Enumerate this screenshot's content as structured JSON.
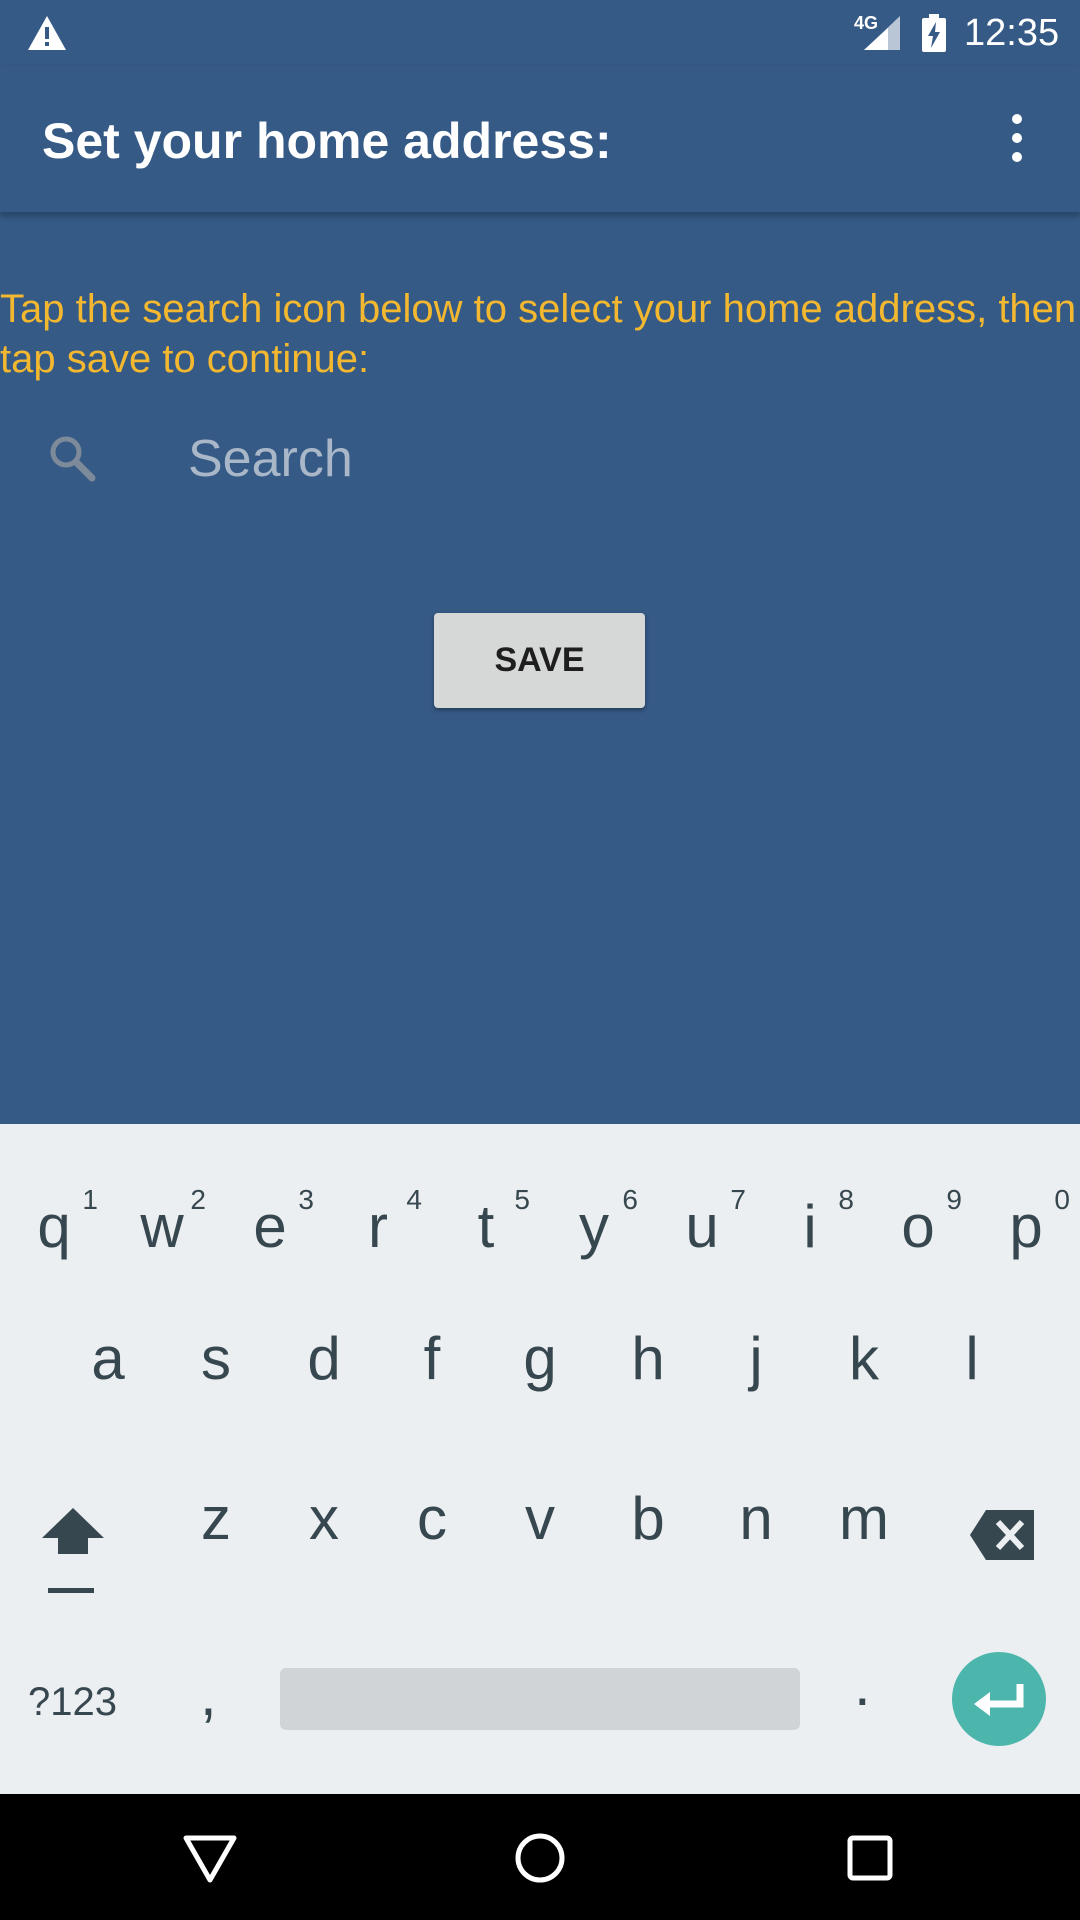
{
  "status_bar": {
    "network": "4G",
    "time": "12:35",
    "icons": [
      "warning-icon",
      "signal-icon",
      "battery-charging-icon"
    ]
  },
  "app_bar": {
    "title": "Set your home address:",
    "menu_icon": "more-vert-icon"
  },
  "content": {
    "instruction": "Tap the search icon below to select your home address, then tap save to continue:",
    "search": {
      "placeholder": "Search",
      "value": ""
    },
    "save_label": "SAVE"
  },
  "keyboard": {
    "row1": [
      {
        "key": "q",
        "hint": "1"
      },
      {
        "key": "w",
        "hint": "2"
      },
      {
        "key": "e",
        "hint": "3"
      },
      {
        "key": "r",
        "hint": "4"
      },
      {
        "key": "t",
        "hint": "5"
      },
      {
        "key": "y",
        "hint": "6"
      },
      {
        "key": "u",
        "hint": "7"
      },
      {
        "key": "i",
        "hint": "8"
      },
      {
        "key": "o",
        "hint": "9"
      },
      {
        "key": "p",
        "hint": "0"
      }
    ],
    "row2": [
      "a",
      "s",
      "d",
      "f",
      "g",
      "h",
      "j",
      "k",
      "l"
    ],
    "row3": [
      "z",
      "x",
      "c",
      "v",
      "b",
      "n",
      "m"
    ],
    "symbols_label": "?123",
    "comma": ",",
    "period": "."
  },
  "colors": {
    "background": "#355a85",
    "instruction_text": "#f3b830",
    "keyboard_bg": "#eceff1",
    "enter_key": "#4db6ac"
  }
}
